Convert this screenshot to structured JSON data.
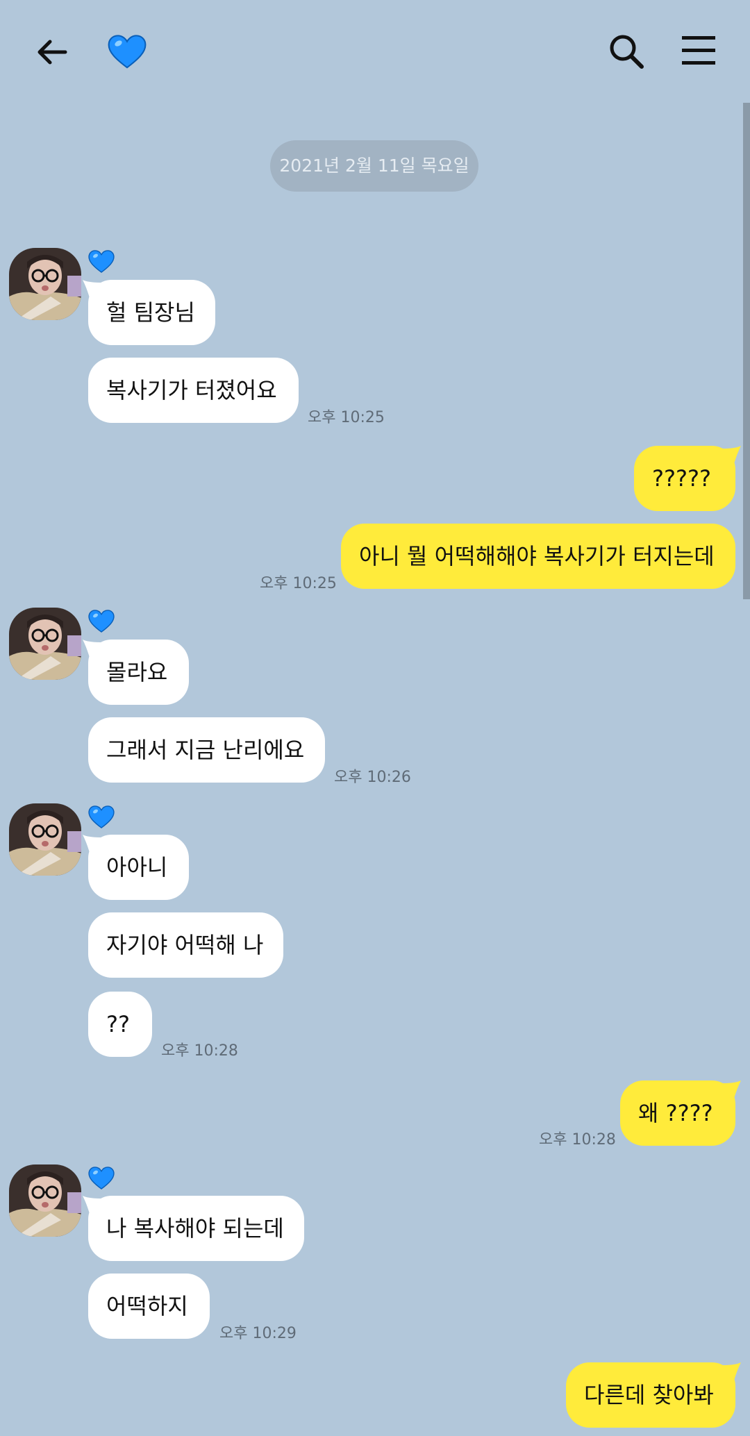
{
  "header": {
    "chat_name_icon": "blue-heart-icon",
    "back_icon": "back-arrow-icon",
    "search_icon": "search-icon",
    "menu_icon": "menu-icon"
  },
  "date_divider": "2021년 2월 11일 목요일",
  "colors": {
    "background": "#b2c7da",
    "incoming_bubble": "#ffffff",
    "outgoing_bubble": "#ffeb3b",
    "heart": "#1e90ff"
  },
  "messages": {
    "m1": "헐 팀장님",
    "m2": "복사기가 터졌어요",
    "t1": "오후 10:25",
    "m3": "?????",
    "m4": "아니 뭘 어떡해해야 복사기가 터지는데",
    "t2": "오후 10:25",
    "m5": "몰라요",
    "m6": "그래서 지금 난리에요",
    "t3": "오후 10:26",
    "m7": "아아니",
    "m8": "자기야 어떡해 나",
    "m9": "??",
    "t4": "오후 10:28",
    "m10": "왜 ????",
    "t5": "오후 10:28",
    "m11": "나 복사해야 되는데",
    "m12": "어떡하지",
    "t6": "오후 10:29",
    "m13": "다른데 찾아봐"
  }
}
